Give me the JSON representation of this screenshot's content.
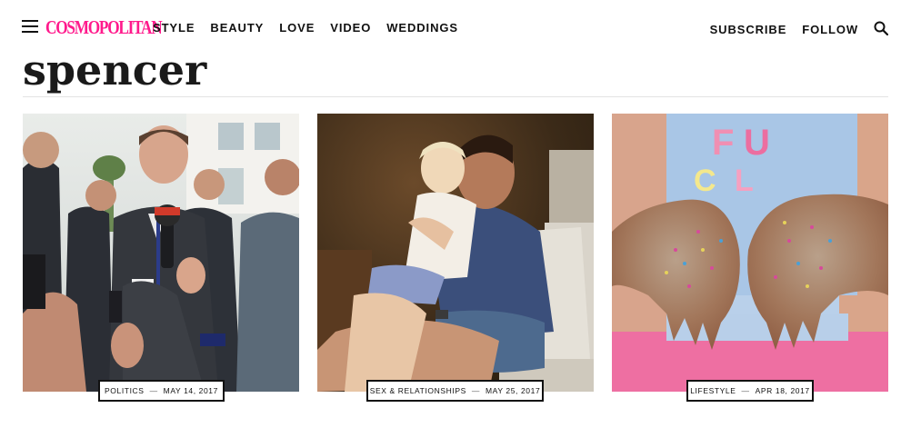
{
  "header": {
    "logo": "COSMOPOLITAN",
    "nav": [
      "STYLE",
      "BEAUTY",
      "LOVE",
      "VIDEO",
      "WEDDINGS"
    ],
    "subscribe": "SUBSCRIBE",
    "follow": "FOLLOW",
    "icons": {
      "menu": "hamburger-icon",
      "search": "search-icon"
    }
  },
  "page": {
    "title": "spencer"
  },
  "cards": [
    {
      "category": "POLITICS",
      "separator": "—",
      "date": "MAY 14, 2017"
    },
    {
      "category": "SEX & RELATIONSHIPS",
      "separator": "—",
      "date": "MAY 25, 2017"
    },
    {
      "category": "LIFESTYLE",
      "separator": "—",
      "date": "APR 18, 2017"
    }
  ],
  "colors": {
    "brand": "#ff1a8c",
    "text": "#111111"
  }
}
